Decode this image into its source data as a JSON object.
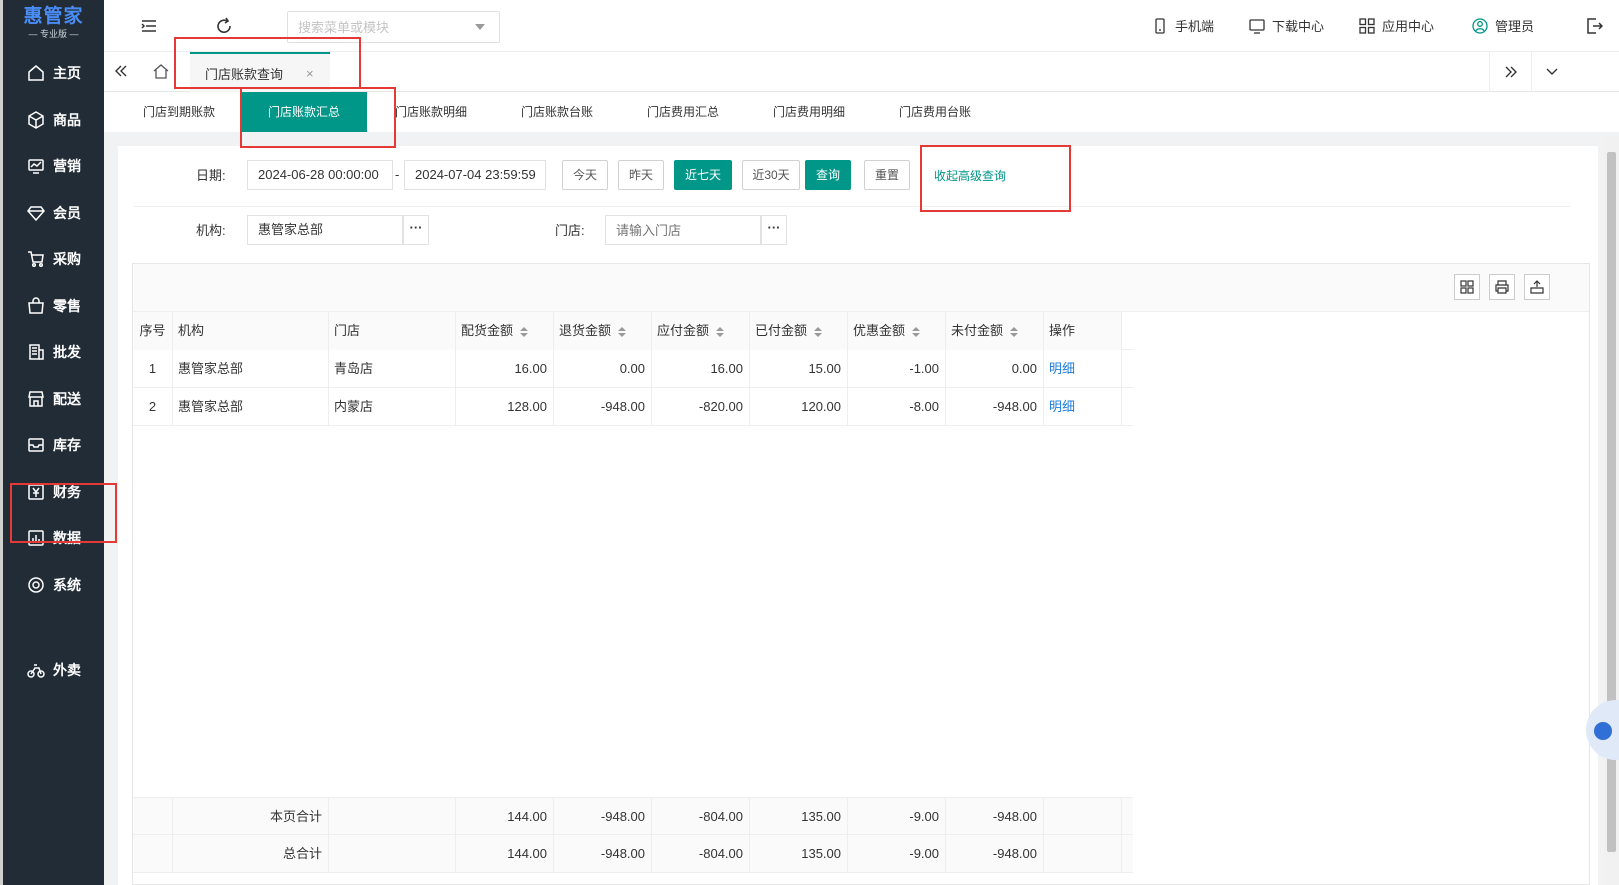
{
  "app": {
    "logo_main": "惠管家",
    "logo_sub": "— 专业版 —"
  },
  "sidebar": {
    "items": [
      {
        "label": "主页",
        "icon": "home-icon"
      },
      {
        "label": "商品",
        "icon": "box-icon"
      },
      {
        "label": "营销",
        "icon": "chart-card-icon"
      },
      {
        "label": "会员",
        "icon": "diamond-icon"
      },
      {
        "label": "采购",
        "icon": "cart-icon"
      },
      {
        "label": "零售",
        "icon": "bag-icon"
      },
      {
        "label": "批发",
        "icon": "building-icon"
      },
      {
        "label": "配送",
        "icon": "store-icon"
      },
      {
        "label": "库存",
        "icon": "inbox-icon"
      },
      {
        "label": "财务",
        "icon": "yuan-icon"
      },
      {
        "label": "数据",
        "icon": "bar-chart-icon"
      },
      {
        "label": "系统",
        "icon": "target-icon"
      },
      {
        "label": "外卖",
        "icon": "bike-icon"
      }
    ]
  },
  "header": {
    "search_placeholder": "搜索菜单或模块",
    "mobile": "手机端",
    "download": "下载中心",
    "apps": "应用中心",
    "user": "管理员"
  },
  "tabs": {
    "open_tab": "门店账款查询"
  },
  "subtabs": [
    "门店到期账款",
    "门店账款汇总",
    "门店账款明细",
    "门店账款台账",
    "门店费用汇总",
    "门店费用明细",
    "门店费用台账"
  ],
  "filters": {
    "date_label": "日期:",
    "date_from": "2024-06-28 00:00:00",
    "date_sep": "-",
    "date_to": "2024-07-04 23:59:59",
    "btn_today": "今天",
    "btn_yesterday": "昨天",
    "btn_7days": "近七天",
    "btn_30days": "近30天",
    "btn_query": "查询",
    "btn_reset": "重置",
    "collapse_link": "收起高级查询",
    "org_label": "机构:",
    "org_value": "惠管家总部",
    "store_label": "门店:",
    "store_placeholder": "请输入门店",
    "more": "···"
  },
  "table": {
    "columns": [
      "序号",
      "机构",
      "门店",
      "配货金额",
      "退货金额",
      "应付金额",
      "已付金额",
      "优惠金额",
      "未付金额",
      "操作"
    ],
    "rows": [
      {
        "no": "1",
        "org": "惠管家总部",
        "store": "青岛店",
        "dist": "16.00",
        "ret": "0.00",
        "pay": "16.00",
        "paid": "15.00",
        "disc": "-1.00",
        "unpaid": "0.00",
        "op": "明细"
      },
      {
        "no": "2",
        "org": "惠管家总部",
        "store": "内蒙店",
        "dist": "128.00",
        "ret": "-948.00",
        "pay": "-820.00",
        "paid": "120.00",
        "disc": "-8.00",
        "unpaid": "-948.00",
        "op": "明细"
      }
    ],
    "page_total": {
      "label": "本页合计",
      "dist": "144.00",
      "ret": "-948.00",
      "pay": "-804.00",
      "paid": "135.00",
      "disc": "-9.00",
      "unpaid": "-948.00"
    },
    "grand_total": {
      "label": "总合计",
      "dist": "144.00",
      "ret": "-948.00",
      "pay": "-804.00",
      "paid": "135.00",
      "disc": "-9.00",
      "unpaid": "-948.00"
    }
  },
  "colors": {
    "accent": "#009688",
    "sidebar_bg": "#222c36",
    "link": "#1e7bdc",
    "highlight": "#e53935"
  }
}
